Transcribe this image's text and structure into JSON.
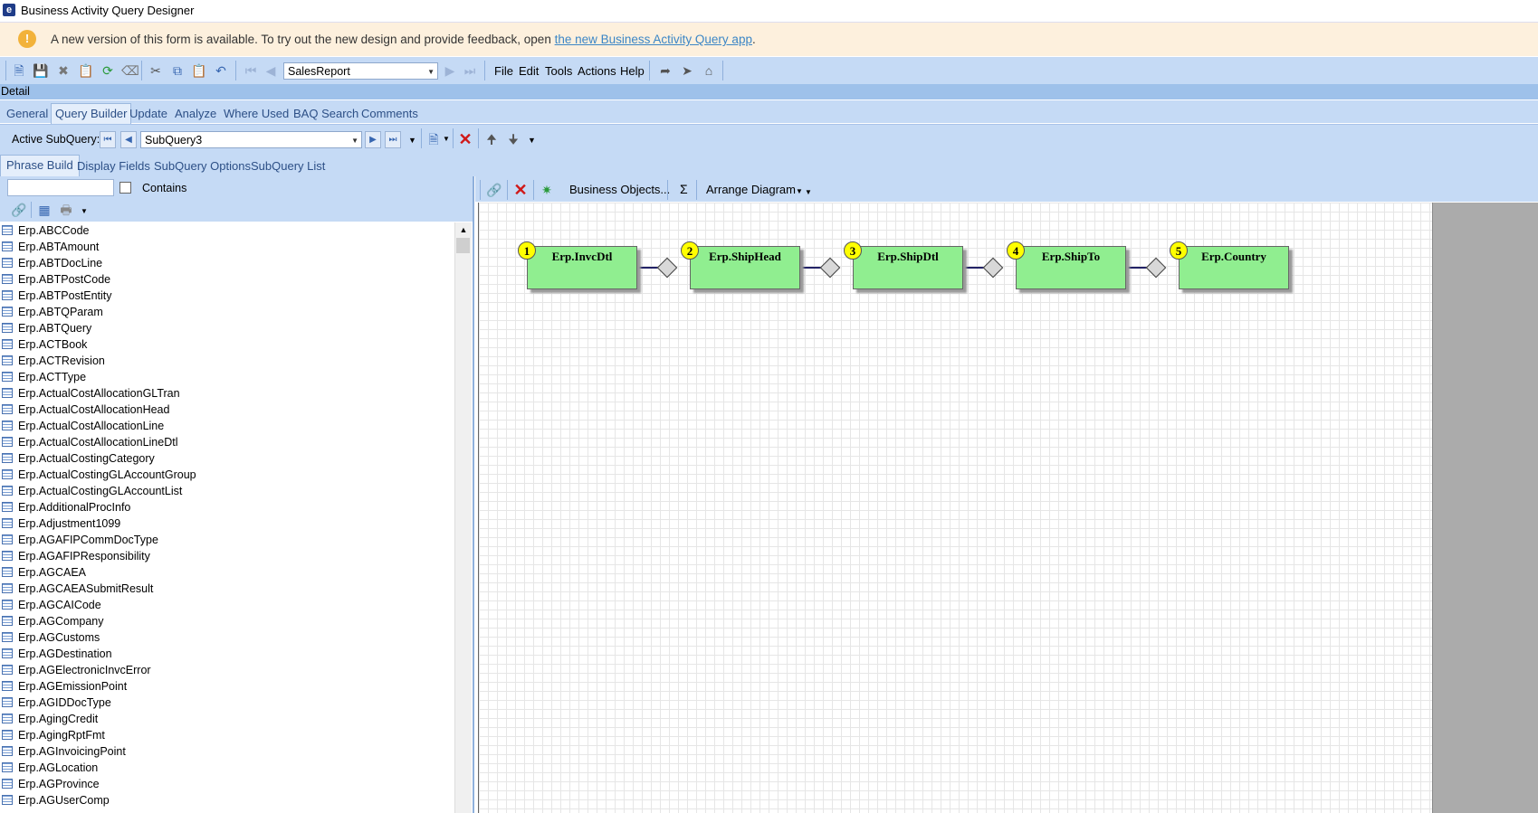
{
  "window": {
    "title": "Business Activity Query Designer",
    "logo": "e"
  },
  "banner": {
    "icon": "!",
    "text": "A new version of this form is available. To try out the new design and provide feedback, open ",
    "link": "the new Business Activity Query app",
    "suffix": "."
  },
  "toolbar": {
    "query_select": "SalesReport",
    "menus": [
      "File",
      "Edit",
      "Tools",
      "Actions",
      "Help"
    ]
  },
  "detail": {
    "label": "Detail"
  },
  "tabs": [
    "General",
    "Query Builder",
    "Update",
    "Analyze",
    "Where Used",
    "BAQ Search",
    "Comments"
  ],
  "subquery": {
    "label": "Active SubQuery:",
    "value": "SubQuery3"
  },
  "subtabs": [
    "Phrase Build",
    "Display Fields",
    "SubQuery Options",
    "SubQuery List"
  ],
  "filter": {
    "search_value": "",
    "contains_label": "Contains"
  },
  "tables": [
    "Erp.ABCCode",
    "Erp.ABTAmount",
    "Erp.ABTDocLine",
    "Erp.ABTPostCode",
    "Erp.ABTPostEntity",
    "Erp.ABTQParam",
    "Erp.ABTQuery",
    "Erp.ACTBook",
    "Erp.ACTRevision",
    "Erp.ACTType",
    "Erp.ActualCostAllocationGLTran",
    "Erp.ActualCostAllocationHead",
    "Erp.ActualCostAllocationLine",
    "Erp.ActualCostAllocationLineDtl",
    "Erp.ActualCostingCategory",
    "Erp.ActualCostingGLAccountGroup",
    "Erp.ActualCostingGLAccountList",
    "Erp.AdditionalProcInfo",
    "Erp.Adjustment1099",
    "Erp.AGAFIPCommDocType",
    "Erp.AGAFIPResponsibility",
    "Erp.AGCAEA",
    "Erp.AGCAEASubmitResult",
    "Erp.AGCAICode",
    "Erp.AGCompany",
    "Erp.AGCustoms",
    "Erp.AGDestination",
    "Erp.AGElectronicInvcError",
    "Erp.AGEmissionPoint",
    "Erp.AGIDDocType",
    "Erp.AgingCredit",
    "Erp.AgingRptFmt",
    "Erp.AGInvoicingPoint",
    "Erp.AGLocation",
    "Erp.AGProvince",
    "Erp.AGUserComp"
  ],
  "diagram_toolbar": {
    "business_objects": "Business Objects...",
    "sum": "Σ",
    "arrange": "Arrange Diagram"
  },
  "diagram": {
    "nodes": [
      {
        "num": "1",
        "name": "Erp.InvcDtl"
      },
      {
        "num": "2",
        "name": "Erp.ShipHead"
      },
      {
        "num": "3",
        "name": "Erp.ShipDtl"
      },
      {
        "num": "4",
        "name": "Erp.ShipTo"
      },
      {
        "num": "5",
        "name": "Erp.Country"
      }
    ]
  }
}
